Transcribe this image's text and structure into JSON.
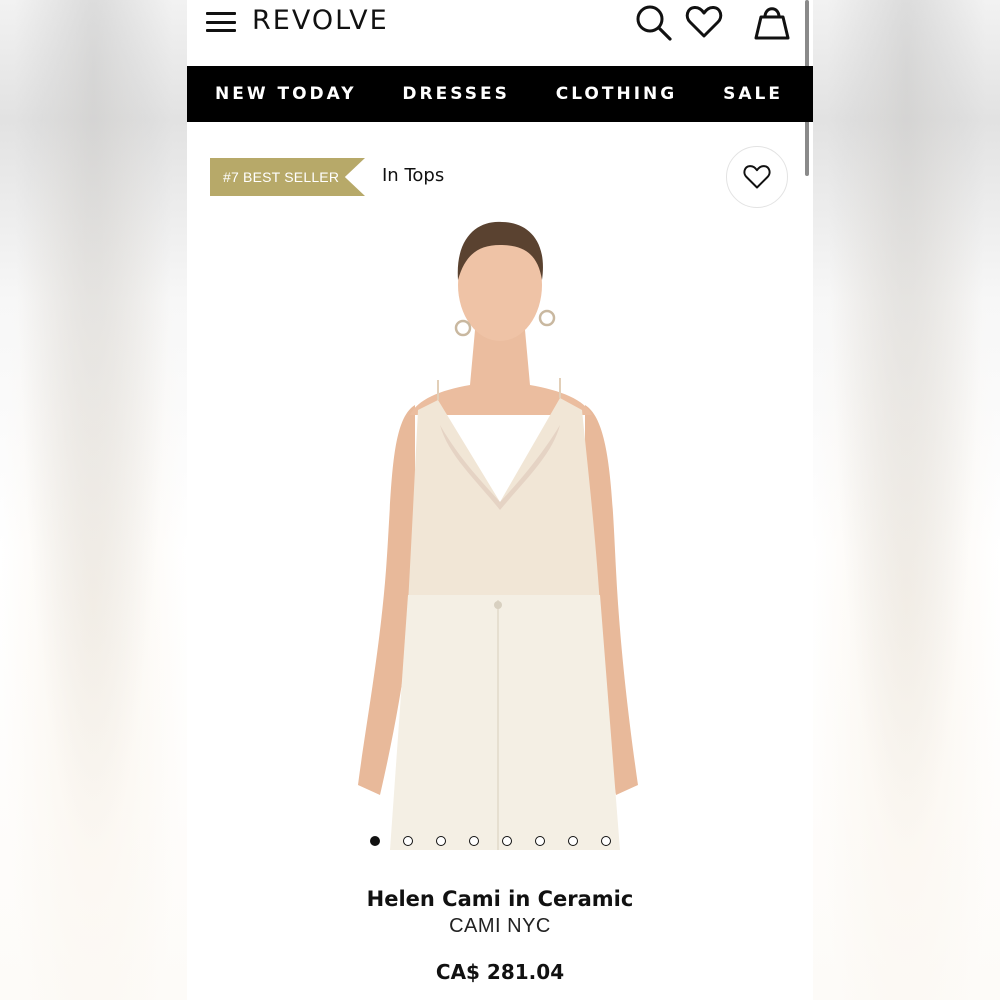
{
  "header": {
    "logo": "REVOLVE",
    "menu_icon": "hamburger-menu-icon",
    "search_icon": "search-icon",
    "wishlist_icon": "heart-icon",
    "bag_icon": "shopping-bag-icon"
  },
  "nav": {
    "items": [
      {
        "label": "NEW TODAY"
      },
      {
        "label": "DRESSES"
      },
      {
        "label": "CLOTHING"
      },
      {
        "label": "SALE"
      }
    ]
  },
  "badge": {
    "label": "#7 BEST SELLER",
    "context": "In Tops",
    "color": "#b7a969"
  },
  "gallery": {
    "image_count": 8,
    "active_index": 0
  },
  "product": {
    "name": "Helen Cami in Ceramic",
    "brand": "CAMI NYC",
    "price": "CA$ 281.04"
  },
  "colors": {
    "nav_background": "#000000",
    "badge_gold": "#b7a969",
    "text": "#111111"
  }
}
